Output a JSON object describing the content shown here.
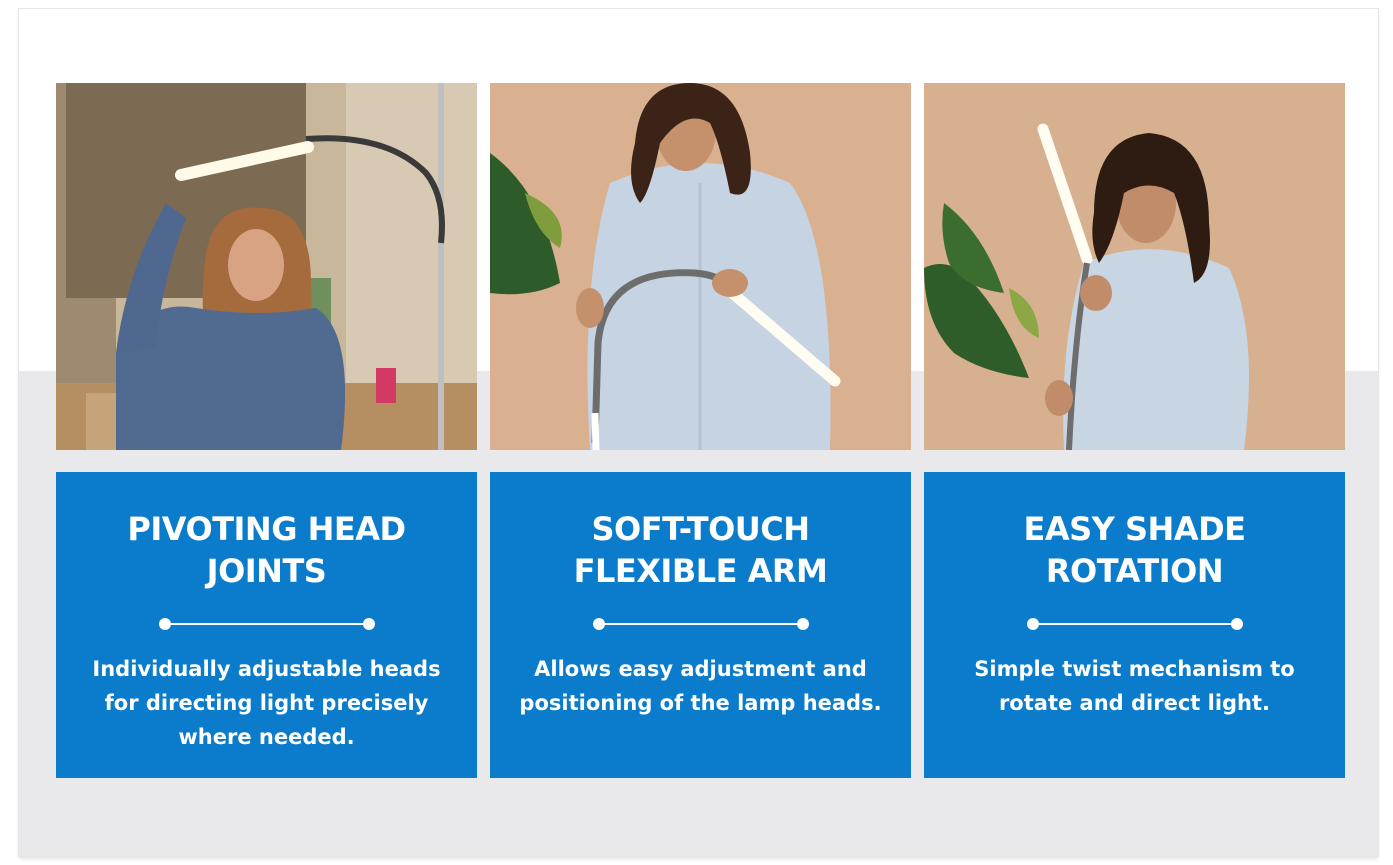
{
  "features": [
    {
      "title": "PIVOTING HEAD JOINTS",
      "description": "Individually adjustable heads for directing light precisely where needed."
    },
    {
      "title": "SOFT-TOUCH FLEXIBLE ARM",
      "description": "Allows easy adjustment and positioning of the lamp heads."
    },
    {
      "title": "EASY SHADE ROTATION",
      "description": "Simple twist mechanism to rotate and direct light."
    }
  ],
  "colors": {
    "card_blue": "#0a7ccb",
    "band_grey": "#e9e9eb",
    "card_text": "#ffffff"
  }
}
